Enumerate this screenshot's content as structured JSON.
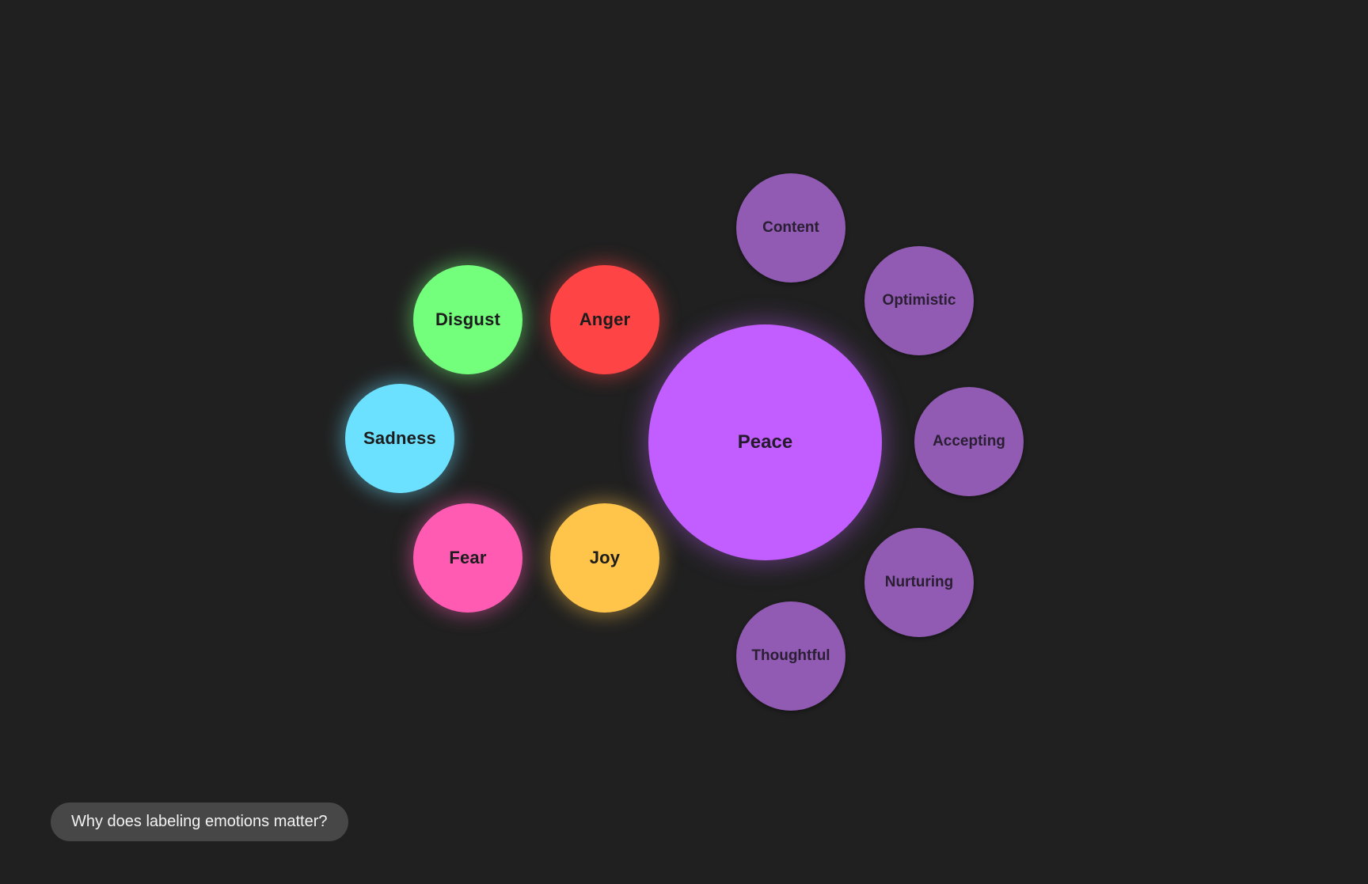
{
  "core_emotions": {
    "disgust": {
      "label": "Disgust",
      "color": "#73FE7B"
    },
    "anger": {
      "label": "Anger",
      "color": "#FF4445"
    },
    "sadness": {
      "label": "Sadness",
      "color": "#6BE1FF"
    },
    "fear": {
      "label": "Fear",
      "color": "#FF5BB3"
    },
    "joy": {
      "label": "Joy",
      "color": "#FFC44A"
    }
  },
  "selected": {
    "label": "Peace",
    "color": "#C25EFF"
  },
  "sub_emotions": {
    "color": "#915BB3",
    "content": "Content",
    "optimistic": "Optimistic",
    "accepting": "Accepting",
    "nurturing": "Nurturing",
    "thoughtful": "Thoughtful"
  },
  "prompt": {
    "question": "Why does labeling emotions matter?"
  },
  "theme": {
    "background": "#202020",
    "chip_background": "#474747"
  }
}
